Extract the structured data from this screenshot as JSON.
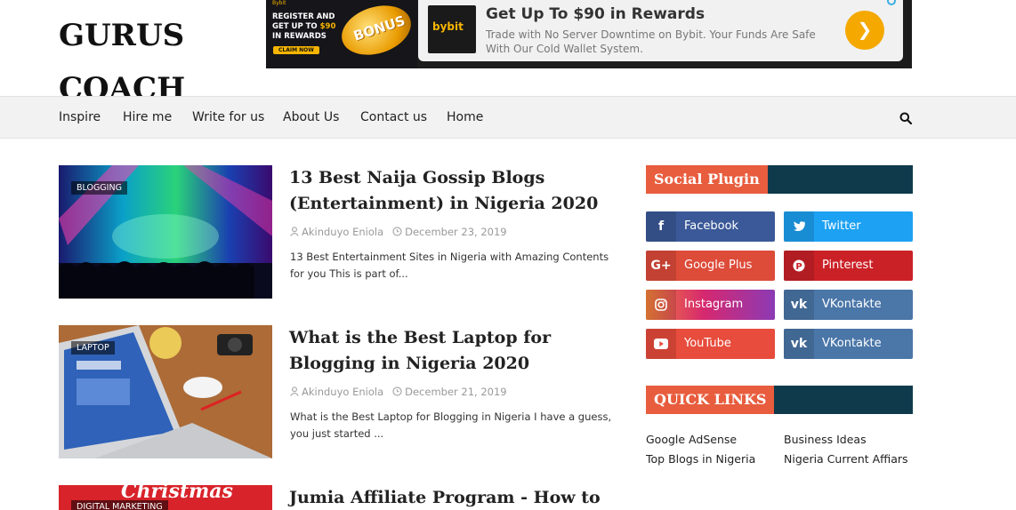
{
  "header": {
    "site_title": "GURUS COACH"
  },
  "ad": {
    "brand_small": "Bybit",
    "promo_line1": "REGISTER AND",
    "promo_line2_prefix": "GET UP TO",
    "promo_amount": "$90",
    "promo_line3": "IN REWARDS",
    "claim_label": "CLAIM NOW",
    "bonus_label": "BONUS",
    "logo_text": "bybit",
    "headline": "Get Up To $90 in Rewards",
    "body": "Trade with No Server Downtime on Bybit. Your Funds Are Safe With Our Cold Wallet System.",
    "cta_icon": "chevron-right-icon",
    "accent_color": "#f5a800"
  },
  "nav": {
    "items": [
      "Inspire",
      "Hire me",
      "Write for us",
      "About Us",
      "Contact us",
      "Home"
    ],
    "search_icon": "search-icon"
  },
  "posts": [
    {
      "label": "BLOGGING",
      "title": "13 Best Naija Gossip Blogs (Entertainment) in Nigeria 2020",
      "author": "Akinduyo Eniola",
      "date": "December 23, 2019",
      "excerpt": "13 Best Entertainment Sites in Nigeria with Amazing Contents for you This is part of..."
    },
    {
      "label": "LAPTOP",
      "title": "What is the Best Laptop for Blogging in Nigeria 2020",
      "author": "Akinduyo Eniola",
      "date": "December 21, 2019",
      "excerpt": "What is the Best Laptop for Blogging in Nigeria I have a guess, you just started ..."
    },
    {
      "label": "DIGITAL MARKETING",
      "title": "Jumia Affiliate Program - How to",
      "image_text": "Christmas"
    }
  ],
  "sidebar": {
    "social_title": "Social Plugin",
    "social": [
      {
        "label": "Facebook",
        "icon": "facebook-icon",
        "glyph": "f",
        "color": "#3b5998"
      },
      {
        "label": "Twitter",
        "icon": "twitter-icon",
        "glyph": "t",
        "color": "#1da1f2"
      },
      {
        "label": "Google Plus",
        "icon": "google-plus-icon",
        "glyph": "G+",
        "color": "#dd4b39"
      },
      {
        "label": "Pinterest",
        "icon": "pinterest-icon",
        "glyph": "P",
        "color": "#ca2127"
      },
      {
        "label": "Instagram",
        "icon": "instagram-icon",
        "glyph": "◎",
        "color": "#e1306c"
      },
      {
        "label": "VKontakte",
        "icon": "vk-icon",
        "glyph": "vk",
        "color": "#4a76a8"
      },
      {
        "label": "YouTube",
        "icon": "youtube-icon",
        "glyph": "▶",
        "color": "#e74c3c"
      },
      {
        "label": "VKontakte",
        "icon": "vk-icon",
        "glyph": "vk",
        "color": "#4a76a8"
      }
    ],
    "quick_links_title": "QUICK LINKS",
    "quick_links": [
      "Google AdSense",
      "Business Ideas",
      "Top Blogs in Nigeria",
      "Nigeria Current Affiars"
    ]
  },
  "colors": {
    "accent": "#e85d3e",
    "widget_dark": "#0e3a4c"
  }
}
